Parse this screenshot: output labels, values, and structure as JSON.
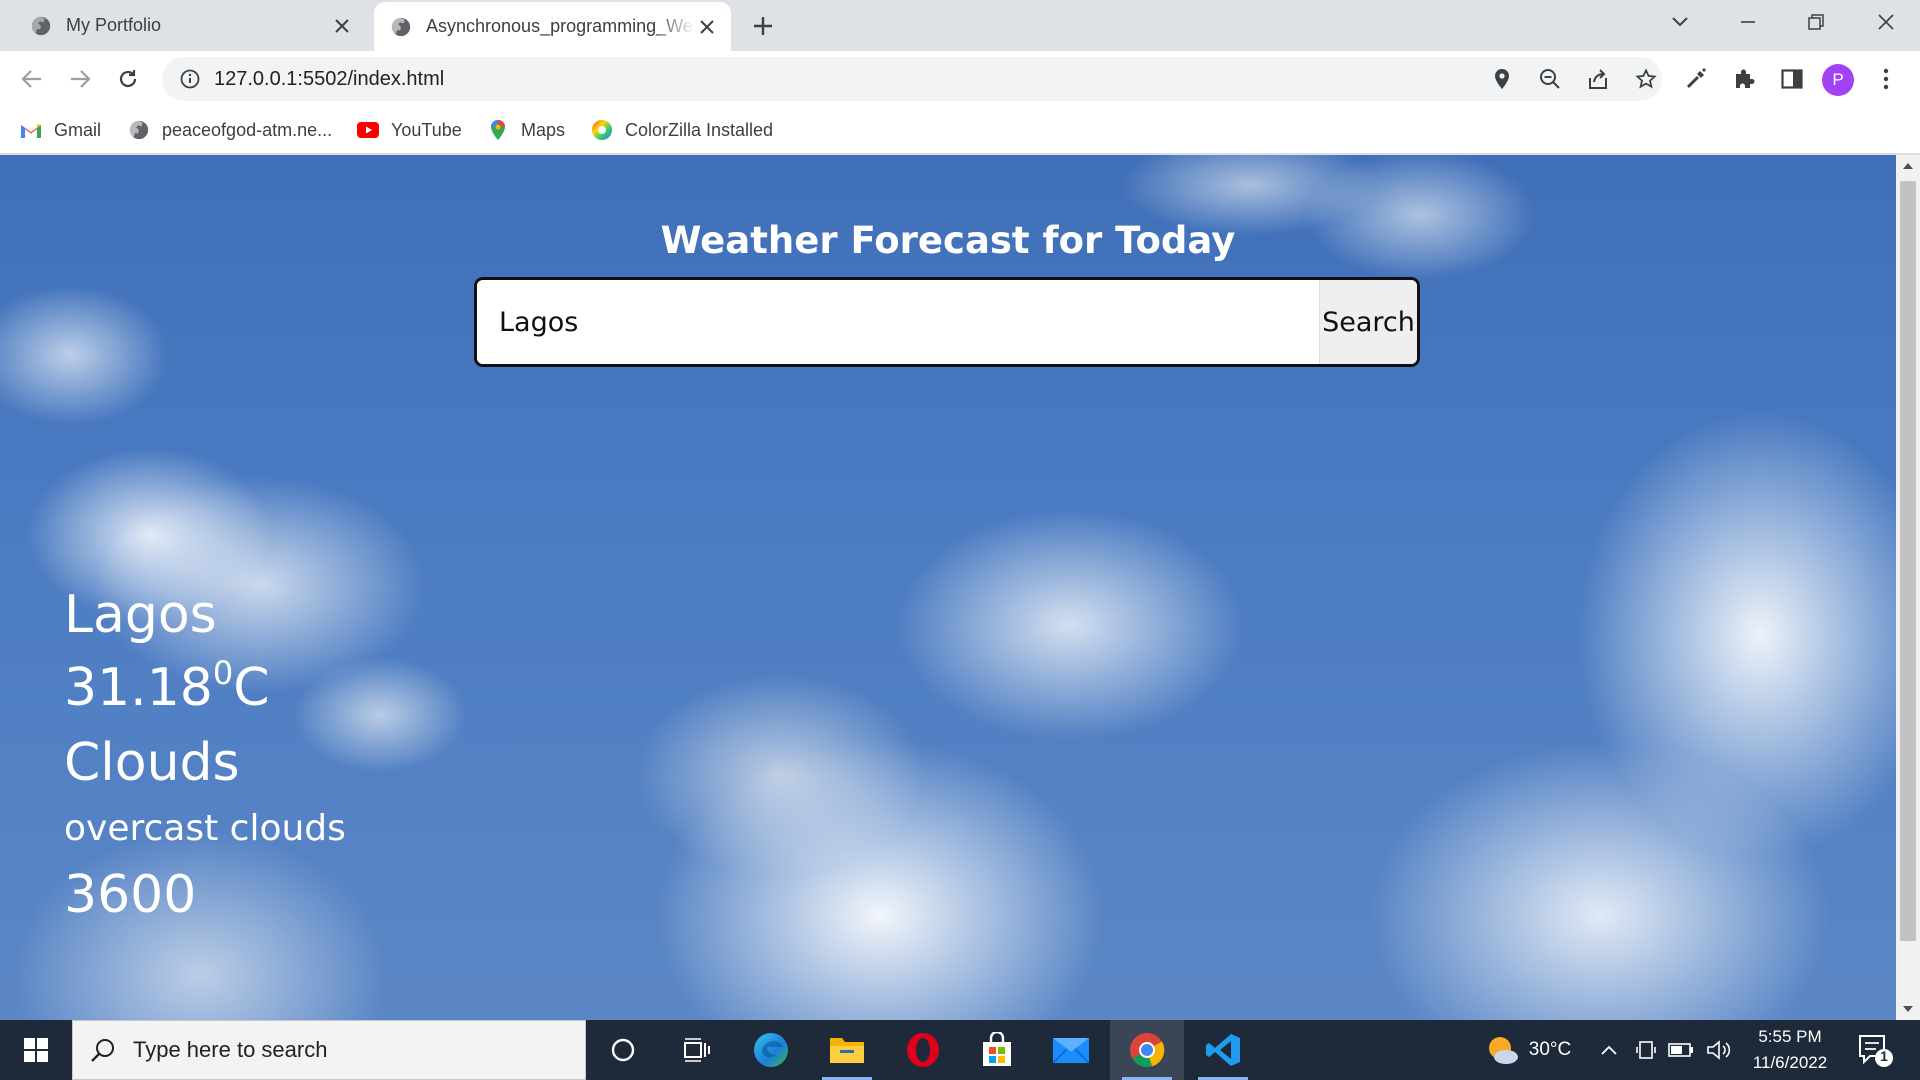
{
  "browser": {
    "tabs": [
      {
        "title": "My Portfolio",
        "active": false
      },
      {
        "title": "Asynchronous_programming_We",
        "active": true
      }
    ],
    "url": "127.0.0.1:5502/index.html",
    "profile_initial": "P",
    "bookmarks": [
      {
        "label": "Gmail",
        "icon": "gmail-icon"
      },
      {
        "label": "peaceofgod-atm.ne...",
        "icon": "globe-icon"
      },
      {
        "label": "YouTube",
        "icon": "youtube-icon"
      },
      {
        "label": "Maps",
        "icon": "maps-icon"
      },
      {
        "label": "ColorZilla Installed",
        "icon": "colorzilla-icon"
      }
    ]
  },
  "page": {
    "heading": "Weather Forecast for Today",
    "search_value": "Lagos",
    "search_button": "Search",
    "weather": {
      "city": "Lagos",
      "temperature": "31.18",
      "degree": "0",
      "unit": "C",
      "condition": "Clouds",
      "description": "overcast clouds",
      "timezone": "3600"
    }
  },
  "taskbar": {
    "search_placeholder": "Type here to search",
    "weather_temp": "30°C",
    "time": "5:55 PM",
    "date": "11/6/2022",
    "notification_count": "1"
  },
  "colors": {
    "sky": "#4a7bc2",
    "taskbar": "#1e2a3a",
    "profile": "#a142f4"
  }
}
